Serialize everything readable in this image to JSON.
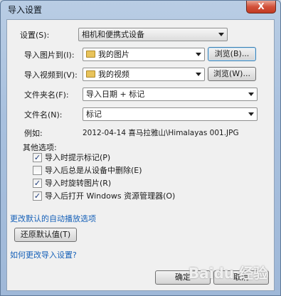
{
  "window": {
    "title": "导入设置",
    "close_label": "X"
  },
  "settings": {
    "label": "设置(S):",
    "value": "相机和便携式设备"
  },
  "import_pictures": {
    "label": "导入图片到(I):",
    "value": "我的图片",
    "browse": "浏览(B)..."
  },
  "import_videos": {
    "label": "导入视频到(V):",
    "value": "我的视频",
    "browse": "浏览(W)..."
  },
  "folder_name": {
    "label": "文件夹名(F):",
    "value": "导入日期 + 标记"
  },
  "file_name": {
    "label": "文件名(N):",
    "value": "标记"
  },
  "example": {
    "label": "例如:",
    "value": "2012-04-14 喜马拉雅山\\Himalayas 001.JPG"
  },
  "other_options": {
    "label": "其他选项:",
    "items": [
      {
        "label": "导入时提示标记(P)",
        "checked": true
      },
      {
        "label": "导入后总是从设备中删除(E)",
        "checked": false
      },
      {
        "label": "导入时旋转图片(R)",
        "checked": true
      },
      {
        "label": "导入后打开 Windows 资源管理器(O)",
        "checked": true
      }
    ]
  },
  "links": {
    "change_autoplay": "更改默认的自动播放选项",
    "how_change": "如何更改导入设置?"
  },
  "buttons": {
    "restore": "还原默认值(T)",
    "ok": "确定",
    "cancel": "取消"
  },
  "watermark": "Baidu 经验"
}
